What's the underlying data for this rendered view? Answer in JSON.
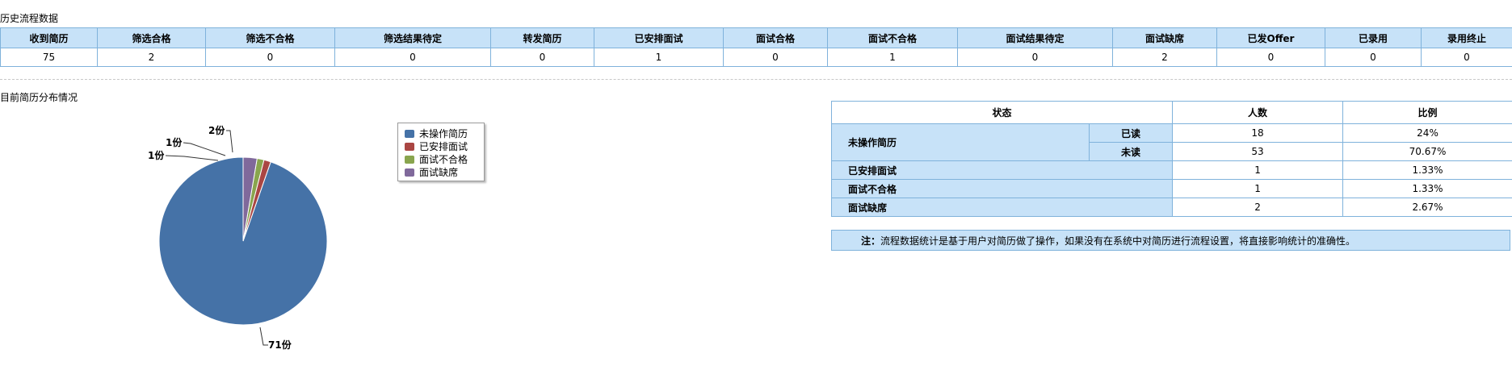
{
  "history": {
    "title": "历史流程数据",
    "headers": [
      "收到简历",
      "筛选合格",
      "筛选不合格",
      "筛选结果待定",
      "转发简历",
      "已安排面试",
      "面试合格",
      "面试不合格",
      "面试结果待定",
      "面试缺席",
      "已发Offer",
      "已录用",
      "录用终止"
    ],
    "values": [
      "75",
      "2",
      "0",
      "0",
      "0",
      "1",
      "0",
      "1",
      "0",
      "2",
      "0",
      "0",
      "0"
    ]
  },
  "distribution": {
    "title": "目前简历分布情况",
    "table_headers": {
      "status": "状态",
      "count": "人数",
      "ratio": "比例"
    },
    "unhandled": {
      "label": "未操作简历",
      "read_label": "已读",
      "read_count": "18",
      "read_ratio": "24%",
      "unread_label": "未读",
      "unread_count": "53",
      "unread_ratio": "70.67%"
    },
    "rows": [
      {
        "label": "已安排面试",
        "count": "1",
        "ratio": "1.33%"
      },
      {
        "label": "面试不合格",
        "count": "1",
        "ratio": "1.33%"
      },
      {
        "label": "面试缺席",
        "count": "2",
        "ratio": "2.67%"
      }
    ],
    "note_prefix": "注：",
    "note_text": "流程数据统计是基于用户对简历做了操作，如果没有在系统中对简历进行流程设置，将直接影响统计的准确性。"
  },
  "chart_data": {
    "type": "pie",
    "categories": [
      "未操作简历",
      "已安排面试",
      "面试不合格",
      "面试缺席"
    ],
    "values": [
      71,
      1,
      1,
      2
    ],
    "data_labels": [
      "71份",
      "1份",
      "1份",
      "2份"
    ],
    "colors": [
      "#4572a7",
      "#aa4643",
      "#89a54e",
      "#80699b"
    ],
    "legend_position": "right"
  }
}
